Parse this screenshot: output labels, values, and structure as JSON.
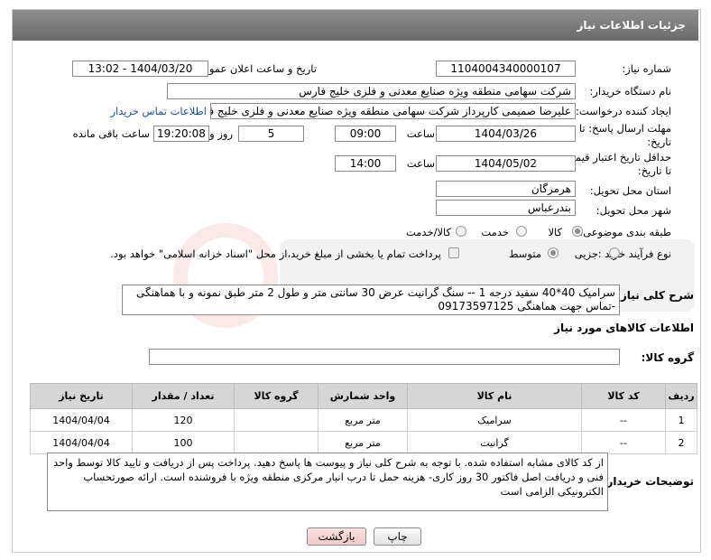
{
  "header": {
    "title": "جزئیات اطلاعات نیاز"
  },
  "form": {
    "need_number_label": "شماره نیاز:",
    "need_number": "1104004340000107",
    "announce_label": "تاریخ و ساعت اعلان عمومی:",
    "announce_value": "1404/03/20 - 13:02",
    "buyer_label": "نام دستگاه خریدار:",
    "buyer_value": "شرکت سهامی منطقه ویژه صنایع معدنی و فلزی خلیج فارس",
    "creator_label": "ایجاد کننده درخواست:",
    "creator_value": "علیرضا صمیمی کارپرداز شرکت سهامی منطقه ویژه صنایع معدنی و فلزی خلیج فارس",
    "contact_link": "اطلاعات تماس خریدار",
    "deadline_label_1": "مهلت ارسال پاسخ: تا",
    "deadline_label_2": "تاریخ:",
    "deadline_date": "1404/03/26",
    "time_word": "ساعت",
    "deadline_time": "09:00",
    "days_count": "5",
    "days_word": "روز و",
    "remaining_time": "19:20:08",
    "remaining_word": "ساعت باقی مانده",
    "validity_label_1": "حداقل تاریخ اعتبار قیمت:",
    "validity_label_2": "تا تاریخ:",
    "validity_date": "1404/05/02",
    "validity_time": "14:00",
    "province_label": "استان محل تحویل:",
    "province_value": "هرمزگان",
    "city_label": "شهر محل تحویل:",
    "city_value": "بندرعباس",
    "category_label": "طبقه بندی موضوعی:",
    "category_options": [
      "کالا",
      "خدمت",
      "کالا/خدمت"
    ],
    "process_label": "نوع فرآیند خرید :",
    "process_options": [
      "جزیی",
      "متوسط"
    ],
    "payment_note": "پرداخت تمام یا بخشی از مبلغ خرید،از محل \"اسناد خزانه اسلامی\" خواهد بود."
  },
  "description": {
    "label": "شرح کلی نیاز:",
    "text": "سرامیک 40*40 سفید درجه 1 -- سنگ گرانیت عرض 30 سانتی متر و طول 2 متر طبق نمونه و با هماهنگی -تماس جهت هماهنگی 09173597125"
  },
  "goods_section": {
    "title": "اطلاعات کالاهای مورد نیاز",
    "group_label": "گروه کالا:",
    "group_value": ""
  },
  "table": {
    "headers": [
      "ردیف",
      "کد کالا",
      "نام کالا",
      "واحد شمارش",
      "گروه کالا",
      "تعداد / مقدار",
      "تاریخ نیاز"
    ],
    "rows": [
      [
        "1",
        "--",
        "سرامیک",
        "متر مربع",
        "",
        "120",
        "1404/04/04"
      ],
      [
        "2",
        "--",
        "گرانیت",
        "متر مربع",
        "",
        "100",
        "1404/04/04"
      ]
    ]
  },
  "buyer_notes": {
    "label": "توضیحات خریدار:",
    "text": "از کد کالای مشابه استفاده شده. با توجه به شرح کلی نیاز و پیوست ها پاسخ دهید. پرداخت پس از دریافت و تایید کالا توسط واحد فنی و دریافت اصل فاکتور 30 روز کاری- هزینه حمل تا درب انبار مرکزی منطقه ویژه با فروشنده است. ارائه صورتحساب الکترونیکی الزامی است"
  },
  "buttons": {
    "print": "چاپ",
    "back": "بازگشت"
  },
  "colors": {
    "header_bg": "#7a7a7a",
    "link": "#1a4fa3",
    "back_button_bg": "#f6d2d2"
  }
}
